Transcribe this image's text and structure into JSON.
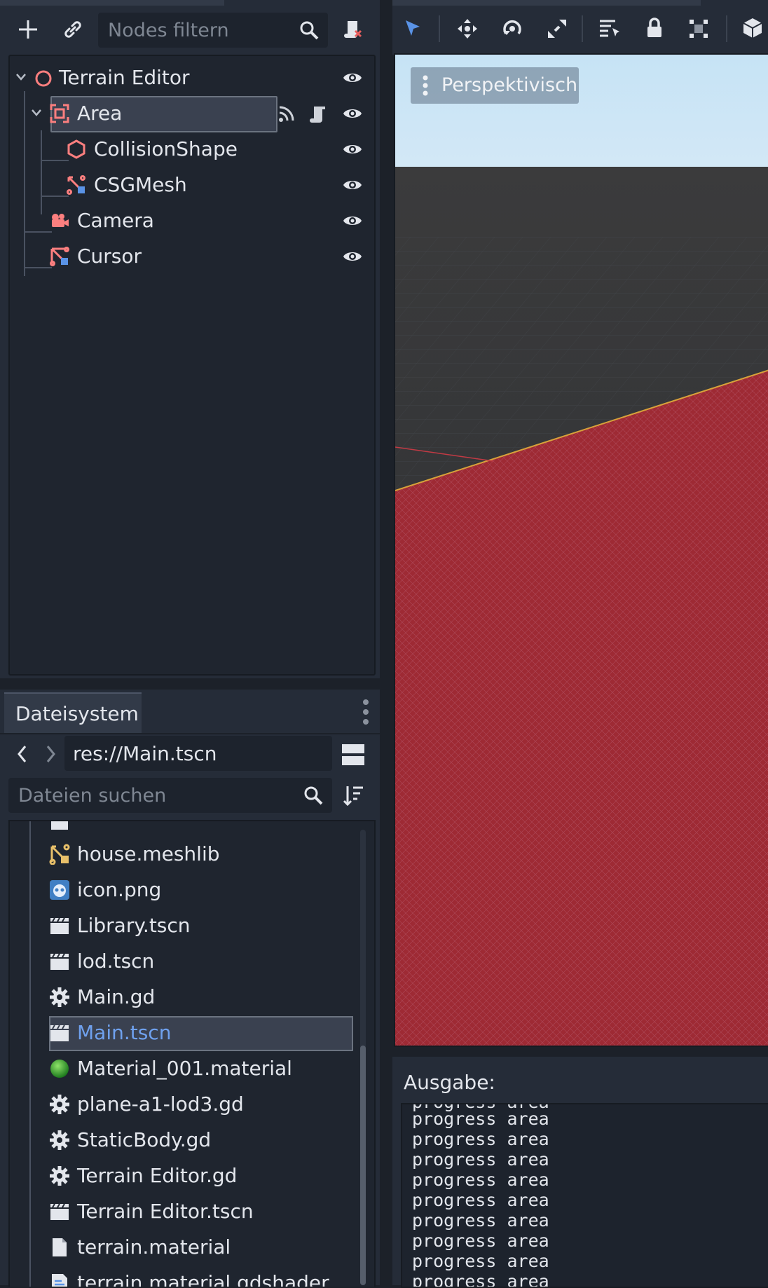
{
  "scene_panel": {
    "filter_placeholder": "Nodes filtern",
    "nodes": [
      {
        "label": "Terrain Editor",
        "icon": "node3d-icon"
      },
      {
        "label": "Area",
        "icon": "area-icon",
        "selected": true
      },
      {
        "label": "CollisionShape",
        "icon": "collision-shape-icon"
      },
      {
        "label": "CSGMesh",
        "icon": "csg-mesh-icon"
      },
      {
        "label": "Camera",
        "icon": "camera-icon"
      },
      {
        "label": "Cursor",
        "icon": "mesh-instance-icon"
      }
    ]
  },
  "filesystem": {
    "tab_label": "Dateisystem",
    "path": "res://Main.tscn",
    "search_placeholder": "Dateien suchen",
    "files": [
      {
        "label": "house.meshlib",
        "icon": "meshlib-icon"
      },
      {
        "label": "icon.png",
        "icon": "godot-image-icon"
      },
      {
        "label": "Library.tscn",
        "icon": "scene-clapper-icon"
      },
      {
        "label": "lod.tscn",
        "icon": "scene-clapper-icon"
      },
      {
        "label": "Main.gd",
        "icon": "script-gear-icon"
      },
      {
        "label": "Main.tscn",
        "icon": "scene-clapper-icon",
        "selected": true
      },
      {
        "label": "Material_001.material",
        "icon": "material-sphere-icon"
      },
      {
        "label": "plane-a1-lod3.gd",
        "icon": "script-gear-icon"
      },
      {
        "label": "StaticBody.gd",
        "icon": "script-gear-icon"
      },
      {
        "label": "Terrain Editor.gd",
        "icon": "script-gear-icon"
      },
      {
        "label": "Terrain Editor.tscn",
        "icon": "scene-clapper-icon"
      },
      {
        "label": "terrain.material",
        "icon": "file-icon"
      },
      {
        "label": "terrain.material.gdshader",
        "icon": "shader-icon"
      }
    ]
  },
  "viewport": {
    "view_mode": "Perspektivisch"
  },
  "output": {
    "header": "Ausgabe:",
    "lines": [
      "progress area",
      "progress area",
      "progress area",
      "progress area",
      "progress area",
      "progress area",
      "progress area",
      "progress area",
      "progress area"
    ]
  },
  "colors": {
    "accent": "#5a93e6",
    "node_icon": "#fc7f7f",
    "panel": "#252c38",
    "tree_bg": "#1f252f",
    "terrain": "#9e2a35",
    "sky": "#c8e3f4"
  }
}
